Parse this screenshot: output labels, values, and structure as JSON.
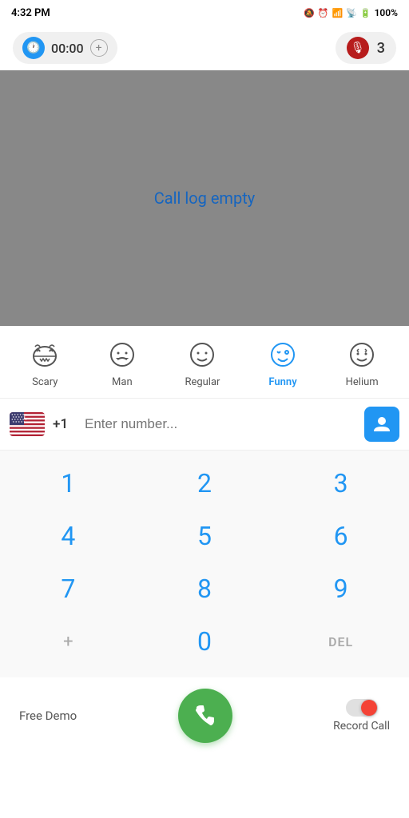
{
  "statusBar": {
    "time": "4:32 PM",
    "batteryPercent": "100%"
  },
  "topBar": {
    "timerValue": "00:00",
    "micCount": "3"
  },
  "callLog": {
    "emptyMessage": "Call log empty"
  },
  "voiceSelector": {
    "items": [
      {
        "id": "scary",
        "label": "Scary",
        "icon": "😈",
        "active": false
      },
      {
        "id": "man",
        "label": "Man",
        "icon": "👨",
        "active": false
      },
      {
        "id": "regular",
        "label": "Regular",
        "icon": "😊",
        "active": false
      },
      {
        "id": "funny",
        "label": "Funny",
        "icon": "🤪",
        "active": true
      },
      {
        "id": "helium",
        "label": "Helium",
        "icon": "😵",
        "active": false
      }
    ]
  },
  "phoneInput": {
    "countryCode": "+1",
    "placeholder": "Enter number..."
  },
  "dialpad": {
    "rows": [
      [
        "1",
        "2",
        "3"
      ],
      [
        "4",
        "5",
        "6"
      ],
      [
        "7",
        "8",
        "9"
      ],
      [
        "+",
        "0",
        "DEL"
      ]
    ]
  },
  "bottomBar": {
    "freeDemoLabel": "Free Demo",
    "recordLabel": "Record Call"
  }
}
